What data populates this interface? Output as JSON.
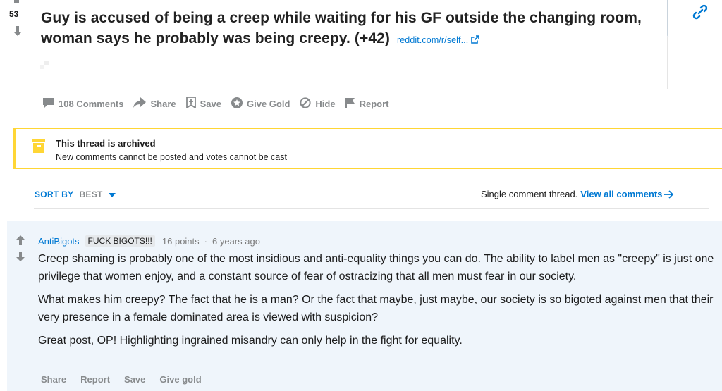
{
  "post": {
    "score": "53",
    "title": "Guy is accused of being a creep while waiting for his GF outside the changing room, woman says he probably was being creepy. (+42)",
    "domain": "reddit.com/r/self..."
  },
  "actions": {
    "comments": "108 Comments",
    "share": "Share",
    "save": "Save",
    "give_gold": "Give Gold",
    "hide": "Hide",
    "report": "Report"
  },
  "archived": {
    "title": "This thread is archived",
    "subtitle": "New comments cannot be posted and votes cannot be cast"
  },
  "sort": {
    "label": "SORT BY",
    "value": "BEST"
  },
  "thread": {
    "single_text": "Single comment thread.",
    "view_all": "View all comments"
  },
  "comment": {
    "author": "AntiBigots",
    "flair": "FUCK BIGOTS!!!",
    "points": "16 points",
    "age": "6 years ago",
    "paragraphs": [
      "Creep shaming is probably one of the most insidious and anti-equality things you can do. The ability to label men as \"creepy\" is just one privilege that women enjoy, and a constant source of fear of ostracizing that all men must fear in our society.",
      "What makes him creepy? The fact that he is a man? Or the fact that maybe, just maybe, our society is so bigoted against men that their very presence in a female dominated area is viewed with suspicion?",
      "Great post, OP! Highlighting ingrained misandry can only help in the fight for equality."
    ],
    "actions": {
      "share": "Share",
      "report": "Report",
      "save": "Save",
      "give_gold": "Give gold"
    }
  },
  "colors": {
    "link_blue": "#0079d3",
    "muted_gray": "#878a8c",
    "archived_accent": "#ffd635",
    "comment_bg": "#eff5fb"
  },
  "icons": {
    "upvote": "arrow-up-icon",
    "downvote": "arrow-down-icon",
    "comments": "comment-bubble-icon",
    "share": "share-arrow-icon",
    "save": "bookmark-plus-icon",
    "give_gold": "gold-star-icon",
    "hide": "hide-circle-icon",
    "report": "flag-icon",
    "archive": "archive-box-icon",
    "link": "link-chain-icon",
    "external": "external-link-icon",
    "caret": "caret-down-icon",
    "view_all_arrow": "arrow-right-icon"
  }
}
